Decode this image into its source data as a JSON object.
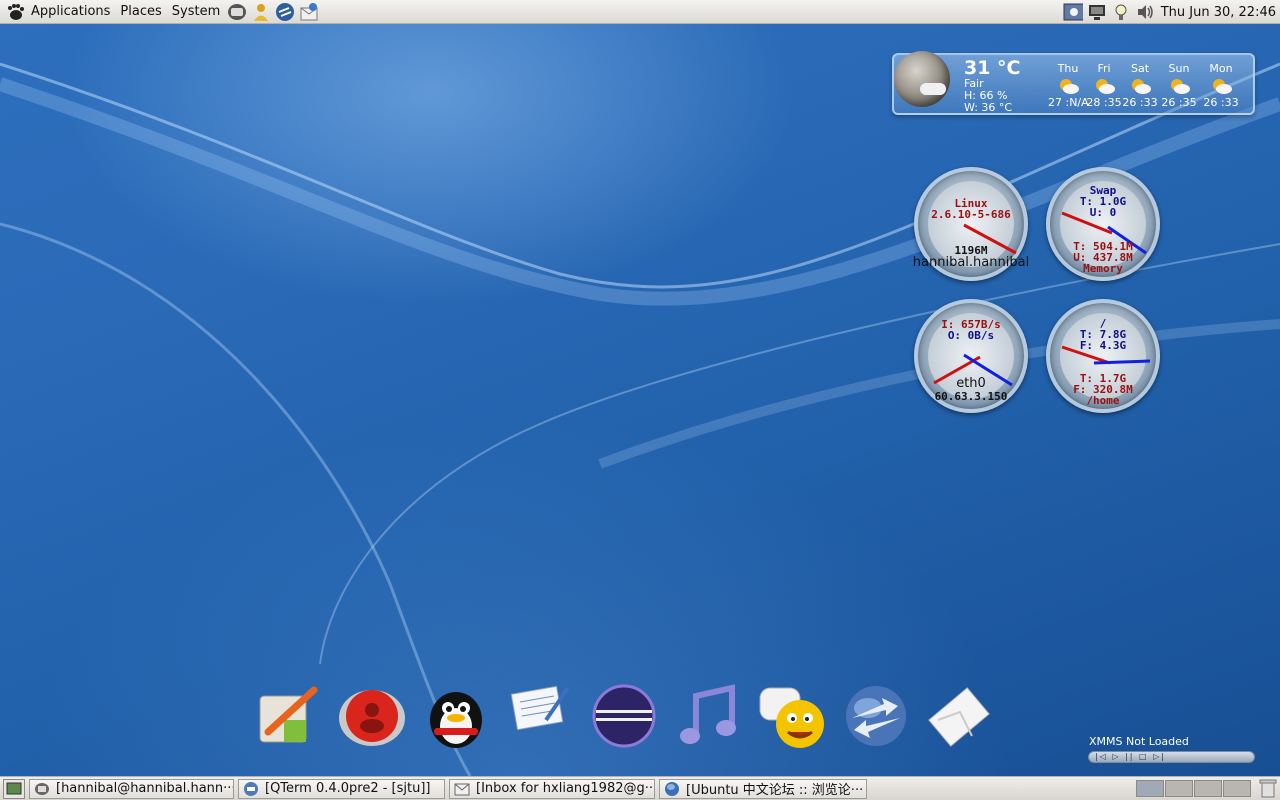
{
  "top_panel": {
    "menus": [
      "Applications",
      "Places",
      "System"
    ],
    "clock": "Thu Jun 30, 22:46",
    "launchers": [
      "terminal-icon",
      "user-icon",
      "network-icon",
      "mail-icon"
    ],
    "tray_icons": [
      "network-manager-icon",
      "display-icon",
      "bulb-icon",
      "volume-icon"
    ]
  },
  "weather": {
    "temperature": "31 °C",
    "condition": "Fair",
    "humidity": "H: 66 %",
    "wind": "W: 36 °C",
    "forecast": [
      {
        "day": "Thu",
        "range": "27 :N/A"
      },
      {
        "day": "Fri",
        "range": "28 :35"
      },
      {
        "day": "Sat",
        "range": "26 :33"
      },
      {
        "day": "Sun",
        "range": "26 :35"
      },
      {
        "day": "Mon",
        "range": "26 :33"
      }
    ]
  },
  "gauges": {
    "system": {
      "os": "Linux",
      "kernel": "2.6.10-5-686",
      "memory": "1196M",
      "host": "hannibal.hannibal"
    },
    "memory": {
      "swap_label": "Swap",
      "swap_total": "T: 1.0G",
      "swap_used": "U: 0",
      "mem_total": "T: 504.1M",
      "mem_used": "U: 437.8M",
      "mem_label": "Memory"
    },
    "network": {
      "incoming": "I: 657B/s",
      "outgoing": "O: 0B/s",
      "iface": "eth0",
      "ip": "60.63.3.150"
    },
    "disk": {
      "root_label": "/",
      "root_total": "T: 7.8G",
      "root_free": "F: 4.3G",
      "home_total": "T: 1.7G",
      "home_free": "F: 320.8M",
      "home_label": "/home"
    }
  },
  "dock": [
    "paint-icon",
    "user-icon",
    "qq-penguin-icon",
    "notepad-icon",
    "eclipse-icon",
    "music-icon",
    "chat-icon",
    "network-sync-icon",
    "mail-icon"
  ],
  "xmms": {
    "status": "XMMS Not Loaded",
    "controls": "|◁ ▷ || □ ▷|"
  },
  "taskbar": {
    "tasks": [
      {
        "label": "[hannibal@hannibal.hann···"
      },
      {
        "label": "[QTerm 0.4.0pre2 - [sjtu]]"
      },
      {
        "label": "[Inbox for hxliang1982@g···"
      },
      {
        "label": "[Ubuntu 中文论坛 :: 浏览论···"
      }
    ]
  }
}
